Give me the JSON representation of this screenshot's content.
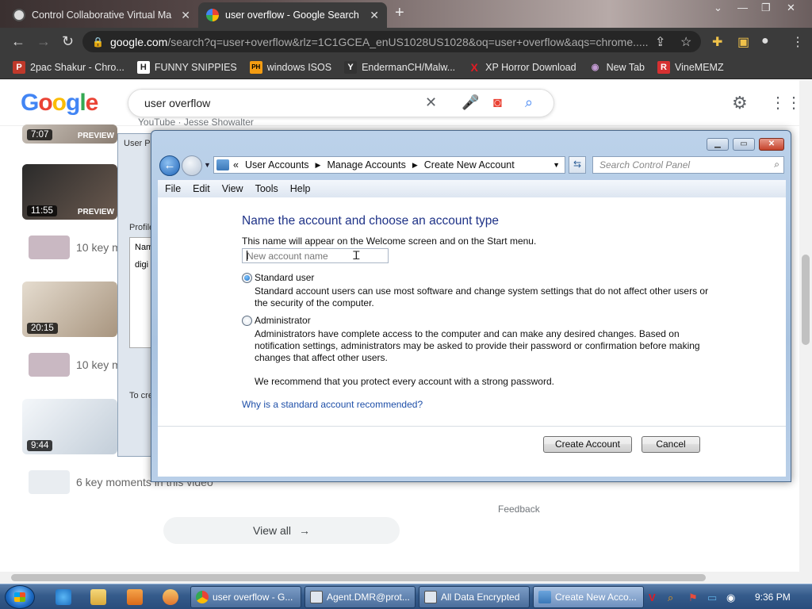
{
  "browser": {
    "tabs": [
      {
        "title": "Control Collaborative Virtual Ma",
        "active": false
      },
      {
        "title": "user overflow - Google Search",
        "active": true
      }
    ],
    "url_host": "google.com",
    "url_rest": "/search?q=user+overflow&rlz=1C1GCEA_enUS1028US1028&oq=user+overflow&aqs=chrome.....",
    "bookmarks": [
      {
        "label": "2pac Shakur - Chro...",
        "icon": "P",
        "color": "#c0392b"
      },
      {
        "label": "FUNNY SNIPPIES",
        "icon": "H",
        "color": "#222222"
      },
      {
        "label": "windows ISOS",
        "icon": "PH",
        "color": "#f39c12"
      },
      {
        "label": "EndermanCH/Malw...",
        "icon": "Y",
        "color": "#333333"
      },
      {
        "label": "XP Horror Download",
        "icon": "X",
        "color": "#e31b23"
      },
      {
        "label": "New Tab",
        "icon": "◉",
        "color": "#8e44ad"
      },
      {
        "label": "VineMEMZ",
        "icon": "R",
        "color": "#d63031"
      }
    ]
  },
  "google": {
    "logo": [
      "G",
      "o",
      "o",
      "g",
      "l",
      "e"
    ],
    "query": "user overflow",
    "video1_duration": "7:07",
    "video2_duration": "11:55",
    "video3_duration": "20:15",
    "video4_duration": "9:44",
    "preview_label": "PREVIEW",
    "moments_10": "10 key m",
    "moments_6": "6 key moments in this video",
    "feedback": "Feedback",
    "view_all": "View all",
    "channel_fragment": "YouTube · Jesse Showalter"
  },
  "bg_window": {
    "title": "User Pr",
    "profile_label": "Profile",
    "name_col": "Nam",
    "row_fragment": "digi",
    "bottom_fragment": "To cre"
  },
  "dialog": {
    "breadcrumbs": [
      "User Accounts",
      "Manage Accounts",
      "Create New Account"
    ],
    "breadcrumb_prefix": "«",
    "search_placeholder": "Search Control Panel",
    "menu": [
      "File",
      "Edit",
      "View",
      "Tools",
      "Help"
    ],
    "heading": "Name the account and choose an account type",
    "description": "This name will appear on the Welcome screen and on the Start menu.",
    "name_placeholder": "New account name",
    "standard_label": "Standard user",
    "standard_text": "Standard account users can use most software and change system settings that do not affect other users or the security of the computer.",
    "admin_label": "Administrator",
    "admin_text": "Administrators have complete access to the computer and can make any desired changes. Based on notification settings, administrators may be asked to provide their password or confirmation before making changes that affect other users.",
    "recommend_text": "We recommend that you protect every account with a strong password.",
    "why_link": "Why is a standard account recommended?",
    "create_button": "Create Account",
    "cancel_button": "Cancel",
    "selected_type": "Standard user"
  },
  "taskbar": {
    "tasks": [
      {
        "label": "user overflow - G...",
        "color": "#4285f4"
      },
      {
        "label": "Agent.DMR@prot...",
        "color": "#dfe6ee"
      },
      {
        "label": "All Data Encrypted",
        "color": "#dfe6ee"
      },
      {
        "label": "Create New Acco...",
        "color": "#6aa4dc"
      }
    ],
    "clock": "9:36 PM"
  }
}
